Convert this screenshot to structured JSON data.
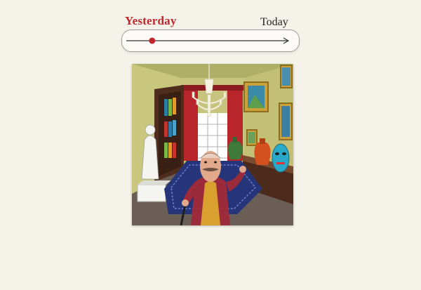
{
  "timeline": {
    "start_label": "Yesterday",
    "end_label": "Today",
    "position": 0.16,
    "accent_color": "#c0262c",
    "track_color": "#333333"
  },
  "scene": {
    "icons": [
      "chandelier-icon",
      "bookshelf-icon",
      "statue-icon",
      "painting-icon",
      "vase-icon",
      "tribal-mask-icon",
      "rug-icon",
      "character-icon",
      "cane-icon"
    ]
  }
}
